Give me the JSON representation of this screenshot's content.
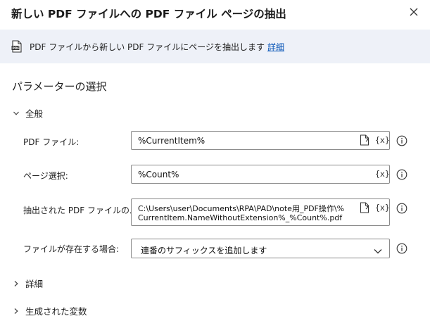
{
  "header": {
    "title": "新しい PDF ファイルへの PDF ファイル ページの抽出"
  },
  "banner": {
    "text": "PDF ファイルから新しい PDF ファイルにページを抽出します",
    "link": "詳細"
  },
  "section_title": "パラメーターの選択",
  "general": {
    "label": "全般",
    "fields": [
      {
        "label": "PDF ファイル:",
        "value": "%CurrentItem%"
      },
      {
        "label": "ページ選択:",
        "value": "%Count%"
      },
      {
        "label": "抽出された PDF ファイルのパス:",
        "value_line1": "C:\\Users\\user\\Documents\\RPA\\PAD\\note用_PDF操作\\%",
        "value_line2": "CurrentItem.NameWithoutExtension%_%Count%.pdf"
      },
      {
        "label": "ファイルが存在する場合:",
        "value": "連番のサフィックスを追加します"
      }
    ],
    "var_button": "{x}"
  },
  "details": {
    "label": "詳細"
  },
  "produced_vars": {
    "label": "生成された変数"
  }
}
